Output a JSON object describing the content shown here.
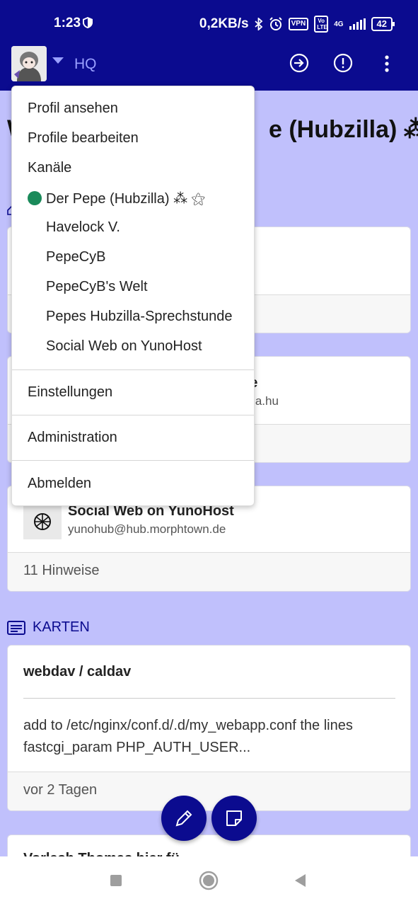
{
  "status_bar": {
    "time": "1:23",
    "network_speed": "0,2KB/s",
    "vpn_label": "VPN",
    "volte_label": "Vo LTE",
    "network_type": "4G",
    "battery": "42"
  },
  "app_bar": {
    "channel_label": "HQ"
  },
  "background": {
    "title_left": "W",
    "title_right": "e (Hubzilla) ⁂",
    "card2_name_tail": "de",
    "card2_address_tail": "zilla.hu",
    "card3": {
      "name": "Social Web on YunoHost",
      "address": "yunohub@hub.morphtown.de",
      "footer": "11 Hinweise"
    },
    "section_label": "KARTEN",
    "card4": {
      "title": "webdav / caldav",
      "body": "add to /etc/nginx/conf.d/.d/my_webapp.conf the lines fastcgi_param PHP_AUTH_USER...",
      "footer": "vor 2 Tagen"
    },
    "card5_title": "Vorlesh Thomas hier fü..."
  },
  "dropdown": {
    "view_profile": "Profil ansehen",
    "edit_profiles": "Profile bearbeiten",
    "channels": "Kanäle",
    "channel_list": [
      "Der Pepe (Hubzilla) ⁂ ⚝",
      "Havelock V.",
      "PepeCyB",
      "PepeCyB's Welt",
      "Pepes Hubzilla-Sprechstunde",
      "Social Web on YunoHost"
    ],
    "settings": "Einstellungen",
    "administration": "Administration",
    "logout": "Abmelden"
  },
  "colors": {
    "primary": "#0b0b8f",
    "page_background": "#c0c0fc",
    "online_dot": "#1a8a5a"
  },
  "icons": {
    "app_bar": [
      "login-arrow-icon",
      "alert-icon",
      "more-vert-icon"
    ],
    "fabs": [
      "pencil-icon",
      "note-icon"
    ],
    "nav": [
      "recents-square-icon",
      "home-circle-icon",
      "back-triangle-icon"
    ]
  }
}
